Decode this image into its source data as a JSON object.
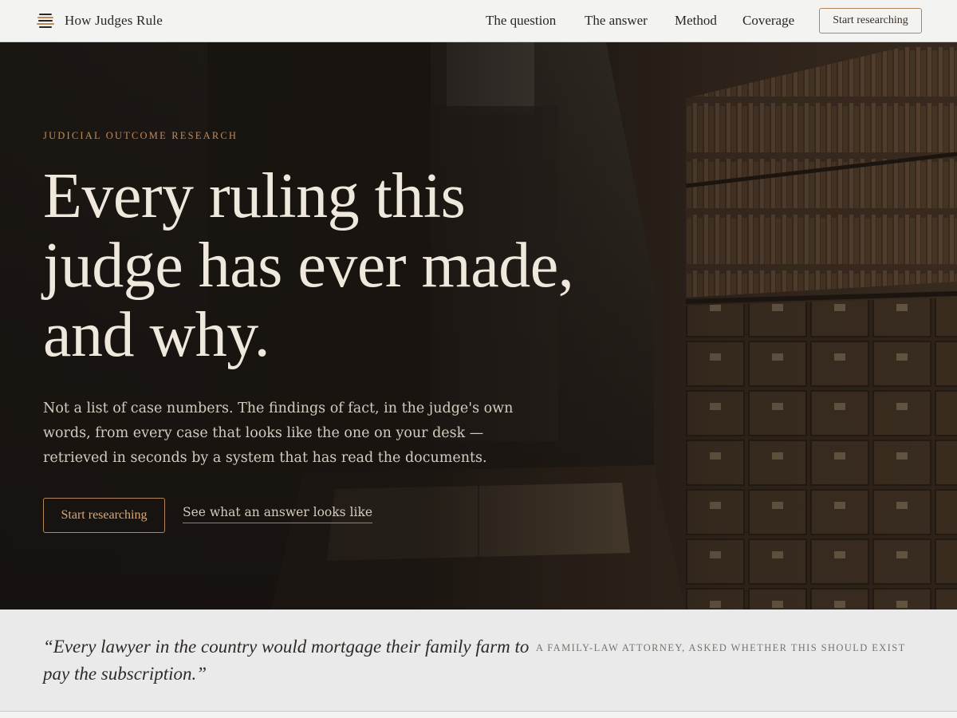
{
  "header": {
    "brand": "How Judges Rule",
    "nav": [
      "The question",
      "The answer",
      "Method",
      "Coverage"
    ],
    "cta": "Start researching"
  },
  "hero": {
    "eyebrow": "JUDICIAL OUTCOME RESEARCH",
    "headline": [
      "Every ruling this",
      "judge has ever made,",
      "and why."
    ],
    "lede": "Not a list of case numbers. The findings of fact, in the judge's own words, from every case that looks like the one on your desk — retrieved in seconds by a system that has read the documents.",
    "primary_cta": "Start researching",
    "secondary_link": "See what an answer looks like"
  },
  "quote": {
    "text": "“Every lawyer in the country would mortgage their family farm to pay the subscription.”",
    "attribution": "A FAMILY-LAW ATTORNEY, ASKED WHETHER THIS SHOULD EXIST"
  },
  "colors": {
    "accent": "#c08a57",
    "hero_bg": "#1b1612",
    "headline": "#efe8dc"
  }
}
